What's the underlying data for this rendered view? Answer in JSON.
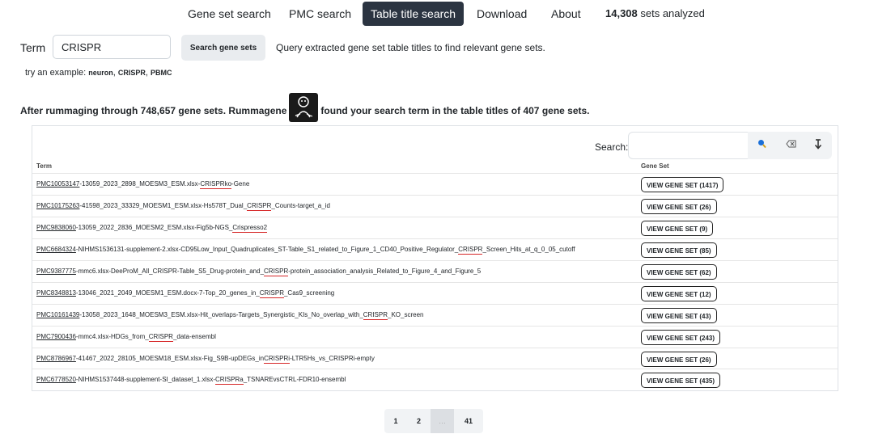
{
  "nav": {
    "items": [
      "Gene set search",
      "PMC search",
      "Table title search",
      "Download",
      "About"
    ],
    "stat_count": "14,308",
    "stat_suffix": " sets analyzed"
  },
  "search": {
    "term_label": "Term",
    "value": "CRISPR",
    "button": "Search gene sets",
    "description": "Query extracted gene set table titles to find relevant gene sets."
  },
  "examples": {
    "prefix": "try an example: ",
    "items": [
      "neuron",
      "CRISPR",
      "PBMC"
    ]
  },
  "summary": {
    "part1": "After rummaging through 748,657 gene sets. Rummagene",
    "part2": "found your search term in the table titles of 407 gene sets."
  },
  "table": {
    "search_label": "Search:",
    "col_term": "Term",
    "col_geneset": "Gene Set",
    "rows": [
      {
        "pmc": "PMC10053147",
        "pre": "-13059_2023_2898_MOESM3_ESM.xlsx-",
        "hl": "CRISPRko",
        "post": "-Gene",
        "btn": "VIEW GENE SET (1417)"
      },
      {
        "pmc": "PMC10175263",
        "pre": "-41598_2023_33329_MOESM1_ESM.xlsx-Hs578T_Dual_",
        "hl": "CRISPR",
        "post": "_Counts-target_a_id",
        "btn": "VIEW GENE SET (26)"
      },
      {
        "pmc": "PMC9838060",
        "pre": "-13059_2022_2836_MOESM2_ESM.xlsx-Fig5b-NGS_",
        "hl": "Crispresso2",
        "post": "",
        "btn": "VIEW GENE SET (9)"
      },
      {
        "pmc": "PMC6684324",
        "pre": "-NIHMS1536131-supplement-2.xlsx-CD95Low_Input_Quadruplicates_ST-Table_S1_related_to_Figure_1_CD40_Positive_Regulator_",
        "hl": "CRISPR",
        "post": "_Screen_Hits_at_q_0_05_cutoff",
        "btn": "VIEW GENE SET (85)"
      },
      {
        "pmc": "PMC9387775",
        "pre": "-mmc6.xlsx-DeeProM_All_CRISPR-Table_S5_Drug-protein_and_",
        "hl": "CRISPR",
        "post": "-protein_association_analysis_Related_to_Figure_4_and_Figure_5",
        "btn": "VIEW GENE SET (62)"
      },
      {
        "pmc": "PMC8348813",
        "pre": "-13046_2021_2049_MOESM1_ESM.docx-7-Top_20_genes_in_",
        "hl": "CRISPR",
        "post": "_Cas9_screening",
        "btn": "VIEW GENE SET (12)"
      },
      {
        "pmc": "PMC10161439",
        "pre": "-13058_2023_1648_MOESM3_ESM.xlsx-Hit_overlaps-Targets_Synergistic_KIs_No_overlap_with_",
        "hl": "CRISPR",
        "post": "_KO_screen",
        "btn": "VIEW GENE SET (43)"
      },
      {
        "pmc": "PMC7900436",
        "pre": "-mmc4.xlsx-HDGs_from_",
        "hl": "CRISPR",
        "post": "_data-ensembl",
        "btn": "VIEW GENE SET (243)"
      },
      {
        "pmc": "PMC8786967",
        "pre": "-41467_2022_28105_MOESM18_ESM.xlsx-Fig_S9B-upDEGs_in",
        "hl": "CRISPRi",
        "post": "-LTR5Hs_vs_CRISPRi-empty",
        "btn": "VIEW GENE SET (26)"
      },
      {
        "pmc": "PMC6778520",
        "pre": "-NIHMS1537448-supplement-SI_dataset_1.xlsx-",
        "hl": "CRISPRa",
        "post": "_TSNAREvsCTRL-FDR10-ensembl",
        "btn": "VIEW GENE SET (435)"
      }
    ]
  },
  "pagination": {
    "pages": [
      "1",
      "2",
      "…",
      "41"
    ]
  },
  "icons": {
    "search": "search-icon",
    "clear": "clear-icon",
    "download": "download-icon",
    "logo": "rummagene-logo"
  }
}
